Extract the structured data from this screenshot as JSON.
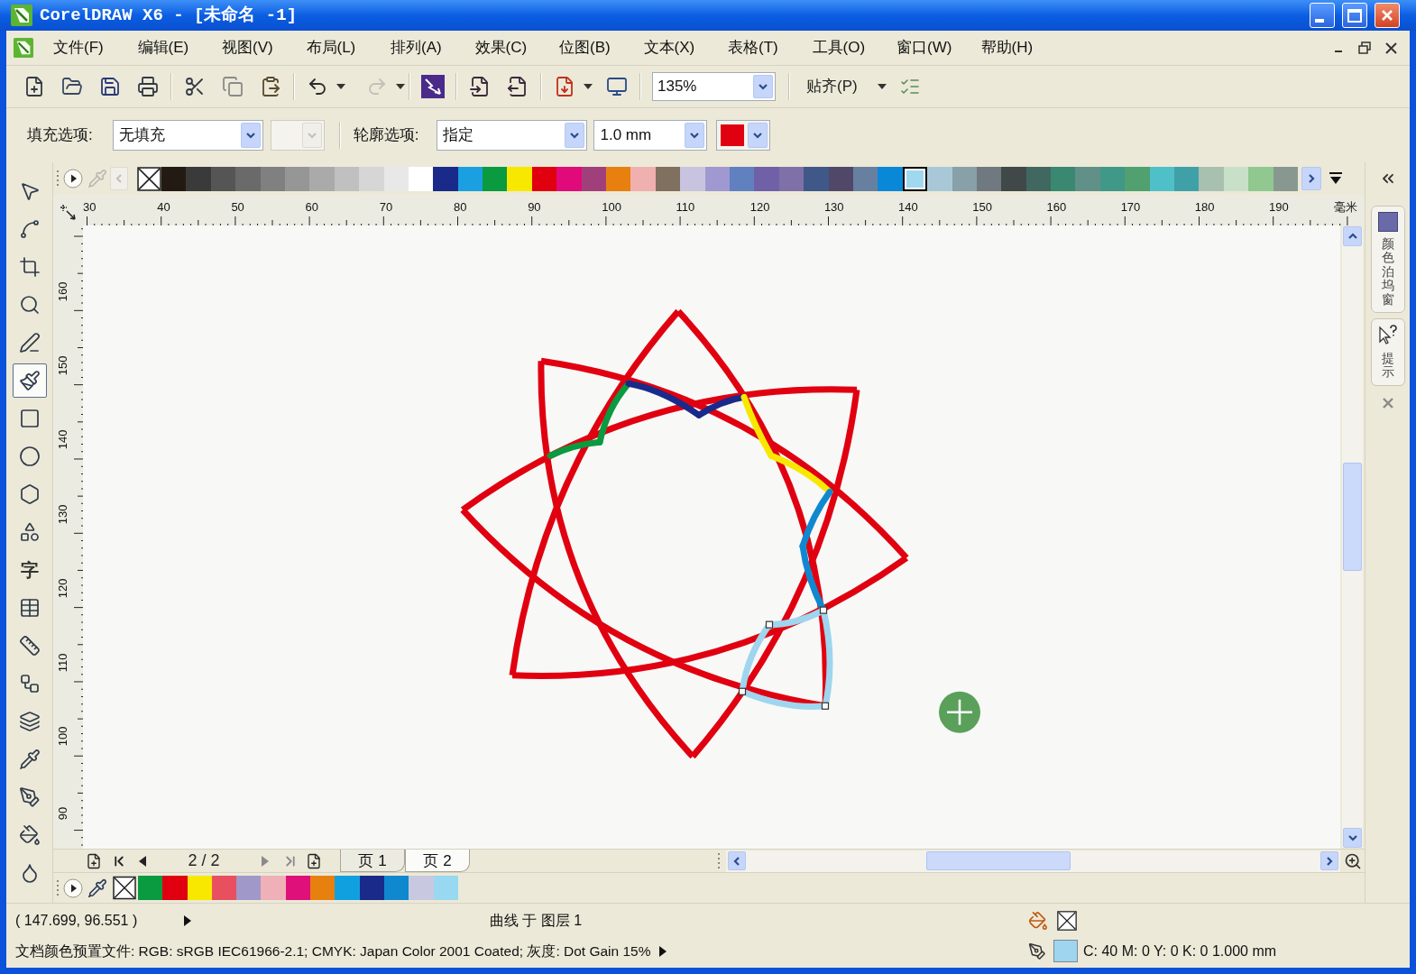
{
  "window": {
    "title": "CorelDRAW X6 - [未命名 -1]"
  },
  "menu": [
    "文件(F)",
    "编辑(E)",
    "视图(V)",
    "布局(L)",
    "排列(A)",
    "效果(C)",
    "位图(B)",
    "文本(X)",
    "表格(T)",
    "工具(O)",
    "窗口(W)",
    "帮助(H)"
  ],
  "toolbar": {
    "redo_disabled": true,
    "zoom": "135%",
    "snap": "贴齐(P)"
  },
  "property_bar": {
    "fill_label": "填充选项:",
    "fill_type": "无填充",
    "fill_color_disabled": true,
    "outline_label": "轮廓选项:",
    "outline_type": "指定",
    "outline_width": "1.0 mm"
  },
  "tools": [
    {
      "kind": "pointer",
      "selected": false
    },
    {
      "kind": "shape",
      "selected": false
    },
    {
      "kind": "crop",
      "selected": false
    },
    {
      "kind": "zoom",
      "selected": false
    },
    {
      "kind": "freehand",
      "selected": false
    },
    {
      "kind": "smart_fill",
      "selected": true
    },
    {
      "kind": "rectangle",
      "selected": false
    },
    {
      "kind": "ellipse",
      "selected": false
    },
    {
      "kind": "polygon",
      "selected": false
    },
    {
      "kind": "basic_shapes",
      "selected": false
    },
    {
      "kind": "text",
      "label": "字",
      "selected": false
    },
    {
      "kind": "table",
      "selected": false
    },
    {
      "kind": "dimension",
      "selected": false
    },
    {
      "kind": "connector",
      "selected": false
    },
    {
      "kind": "blend",
      "selected": false
    },
    {
      "kind": "eyedropper",
      "selected": false
    },
    {
      "kind": "outline",
      "selected": false
    },
    {
      "kind": "fill",
      "selected": false
    },
    {
      "kind": "interactive_fill",
      "selected": false
    }
  ],
  "palette": [
    {
      "color": "#231a14",
      "selected": false
    },
    {
      "color": "#3a3a3a",
      "selected": false
    },
    {
      "color": "#555555",
      "selected": false
    },
    {
      "color": "#6a6a6a",
      "selected": false
    },
    {
      "color": "#808080",
      "selected": false
    },
    {
      "color": "#969696",
      "selected": false
    },
    {
      "color": "#aaaaaa",
      "selected": false
    },
    {
      "color": "#c0c0c0",
      "selected": false
    },
    {
      "color": "#d6d6d6",
      "selected": false
    },
    {
      "color": "#e8e8e8",
      "selected": false
    },
    {
      "color": "#ffffff",
      "selected": false
    },
    {
      "color": "#1a2a8a",
      "selected": false
    },
    {
      "color": "#1aa0e0",
      "selected": false
    },
    {
      "color": "#0a9a40",
      "selected": false
    },
    {
      "color": "#f8e800",
      "selected": false
    },
    {
      "color": "#e00010",
      "selected": false
    },
    {
      "color": "#e00a7a",
      "selected": false
    },
    {
      "color": "#a0407a",
      "selected": false
    },
    {
      "color": "#e88010",
      "selected": false
    },
    {
      "color": "#f0b0b0",
      "selected": false
    },
    {
      "color": "#807060",
      "selected": false
    },
    {
      "color": "#c8c4e0",
      "selected": false
    },
    {
      "color": "#a098d0",
      "selected": false
    },
    {
      "color": "#6080c0",
      "selected": false
    },
    {
      "color": "#7060a8",
      "selected": false
    },
    {
      "color": "#8070a8",
      "selected": false
    },
    {
      "color": "#405888",
      "selected": false
    },
    {
      "color": "#504868",
      "selected": false
    },
    {
      "color": "#6880a0",
      "selected": false
    },
    {
      "color": "#0a88d8",
      "selected": false
    },
    {
      "color": "#a0d8f0",
      "selected": true
    },
    {
      "color": "#a8c8d8",
      "selected": false
    },
    {
      "color": "#88a0a8",
      "selected": false
    },
    {
      "color": "#707880",
      "selected": false
    },
    {
      "color": "#404848",
      "selected": false
    },
    {
      "color": "#406860",
      "selected": false
    },
    {
      "color": "#3a8870",
      "selected": false
    },
    {
      "color": "#609088",
      "selected": false
    },
    {
      "color": "#409888",
      "selected": false
    },
    {
      "color": "#50a070",
      "selected": false
    },
    {
      "color": "#50c0c8",
      "selected": false
    },
    {
      "color": "#40a0a8",
      "selected": false
    },
    {
      "color": "#a8c0b0",
      "selected": false
    },
    {
      "color": "#c8e0c8",
      "selected": false
    },
    {
      "color": "#90c890",
      "selected": false
    },
    {
      "color": "#889890",
      "selected": false
    }
  ],
  "ruler": {
    "x_labels": [
      "30",
      "40",
      "50",
      "60",
      "70",
      "80",
      "90",
      "100",
      "110",
      "120",
      "130",
      "140",
      "150",
      "160",
      "170",
      "180",
      "190"
    ],
    "unit": "毫米",
    "y_labels": [
      "160",
      "150",
      "140",
      "130",
      "120",
      "110",
      "100",
      "90"
    ]
  },
  "docker_tabs": [
    {
      "kind": "color",
      "label": "颜色泊坞窗"
    },
    {
      "kind": "hints",
      "label": "提示"
    }
  ],
  "page_nav": {
    "counter": "2 / 2",
    "pages": [
      {
        "label": "页 1",
        "selected": false
      },
      {
        "label": "页 2",
        "selected": true
      }
    ]
  },
  "document_palette": [
    {
      "color": "#0a9a40"
    },
    {
      "color": "#e00010"
    },
    {
      "color": "#f8e800"
    },
    {
      "color": "#e85060"
    },
    {
      "color": "#a098c8"
    },
    {
      "color": "#f0b0b8"
    },
    {
      "color": "#e0107a"
    },
    {
      "color": "#e88010"
    },
    {
      "color": "#10a0e0"
    },
    {
      "color": "#1a2a8a"
    },
    {
      "color": "#1088d0"
    },
    {
      "color": "#c8c8e0"
    },
    {
      "color": "#98d8f0"
    }
  ],
  "status_bar": {
    "coordinates": "( 147.699, 96.551 )",
    "object_info": "曲线 于 图层 1",
    "color_profile": "文档颜色预置文件: RGB: sRGB IEC61966-2.1; CMYK: Japan Color 2001 Coated; 灰度: Dot Gain 15%",
    "outline_info": "C: 40 M: 0 Y: 0 K: 0 1.000 mm"
  }
}
